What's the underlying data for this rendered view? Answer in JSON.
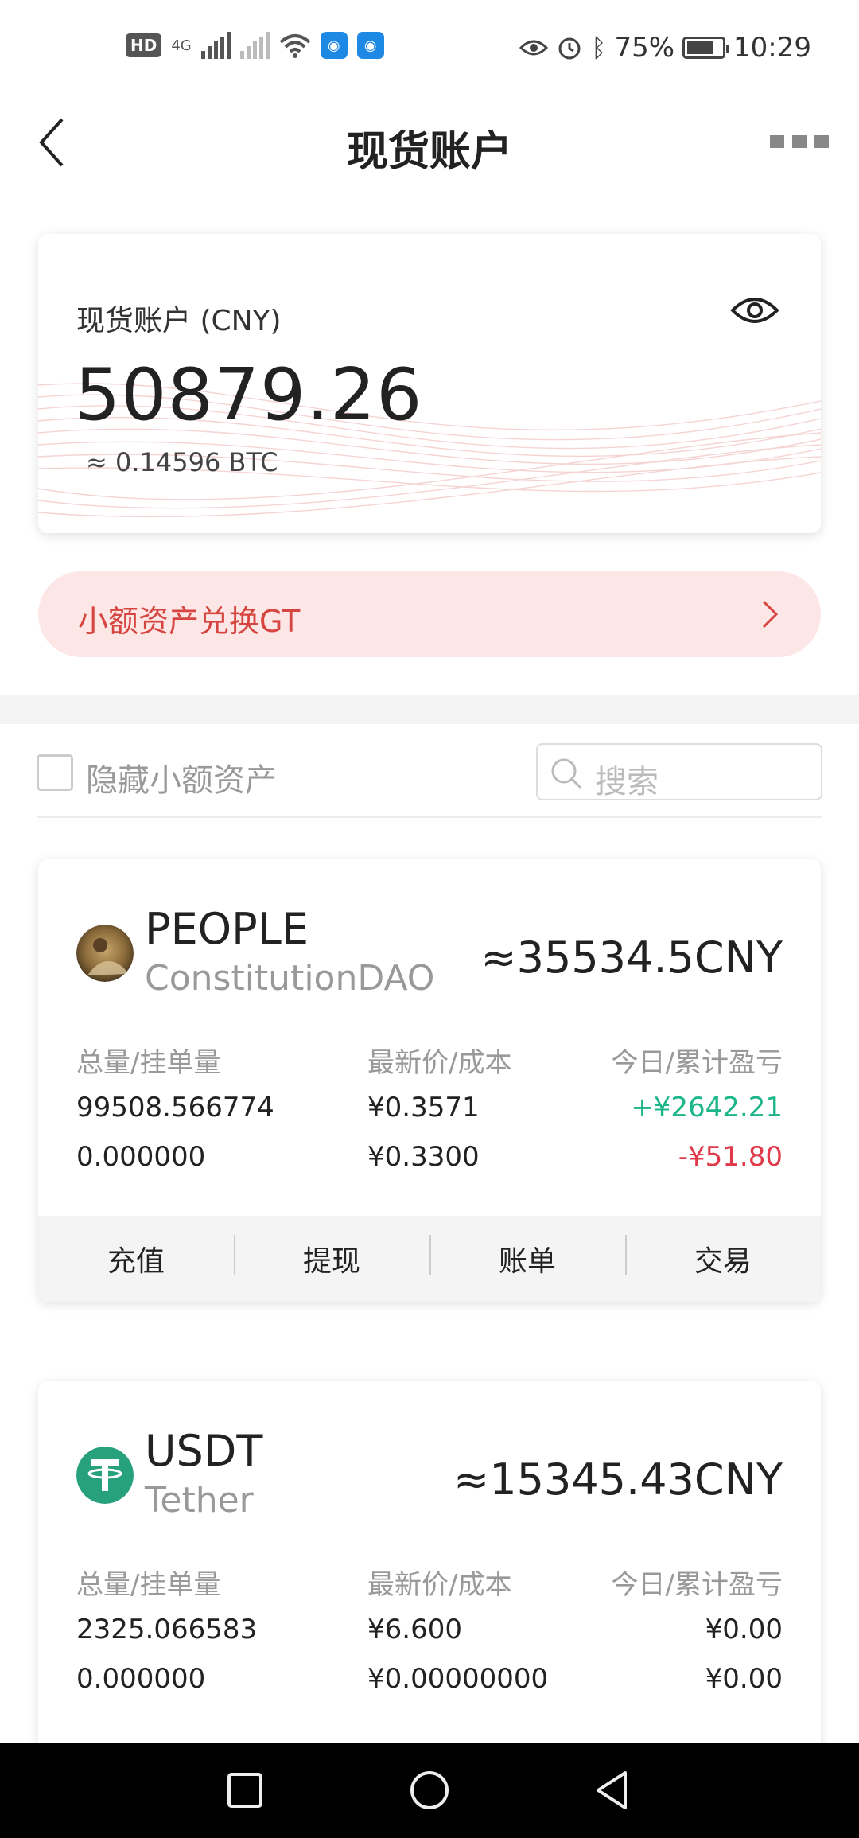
{
  "status_bar": {
    "hd": "HD",
    "network": "4G",
    "battery": "75%",
    "battery_level": 0.75,
    "time": "10:29"
  },
  "header": {
    "title": "现货账户",
    "back_icon": "back-chevron-icon",
    "more_icon": "more-dots-icon"
  },
  "account": {
    "label": "现货账户 (CNY)",
    "amount": "50879.26",
    "btc_equivalent": "≈ 0.14596 BTC",
    "visibility_icon": "eye-icon"
  },
  "convert_banner": {
    "label": "小额资产兑换GT",
    "icon": "chevron-right-icon"
  },
  "filter": {
    "hide_small_label": "隐藏小额资产",
    "hide_small_checked": false,
    "search_placeholder": "搜索"
  },
  "columns": {
    "holdings": "总量/挂单量",
    "price": "最新价/成本",
    "pnl": "今日/累计盈亏"
  },
  "assets": [
    {
      "symbol": "PEOPLE",
      "name": "ConstitutionDAO",
      "value": "≈35534.5CNY",
      "total": "99508.566774",
      "open_orders": "0.000000",
      "latest_price": "¥0.3571",
      "cost": "¥0.3300",
      "pnl_today": "+¥2642.21",
      "pnl_total": "-¥51.80",
      "actions": [
        "充值",
        "提现",
        "账单",
        "交易"
      ]
    },
    {
      "symbol": "USDT",
      "name": "Tether",
      "value": "≈15345.43CNY",
      "total": "2325.066583",
      "open_orders": "0.000000",
      "latest_price": "¥6.600",
      "cost": "¥0.00000000",
      "pnl_today": "¥0.00",
      "pnl_total": "¥0.00"
    }
  ],
  "colors": {
    "accent_red": "#d6453f",
    "gain_green": "#1db58a",
    "loss_red": "#e0394a",
    "tether_green": "#26a17b"
  }
}
